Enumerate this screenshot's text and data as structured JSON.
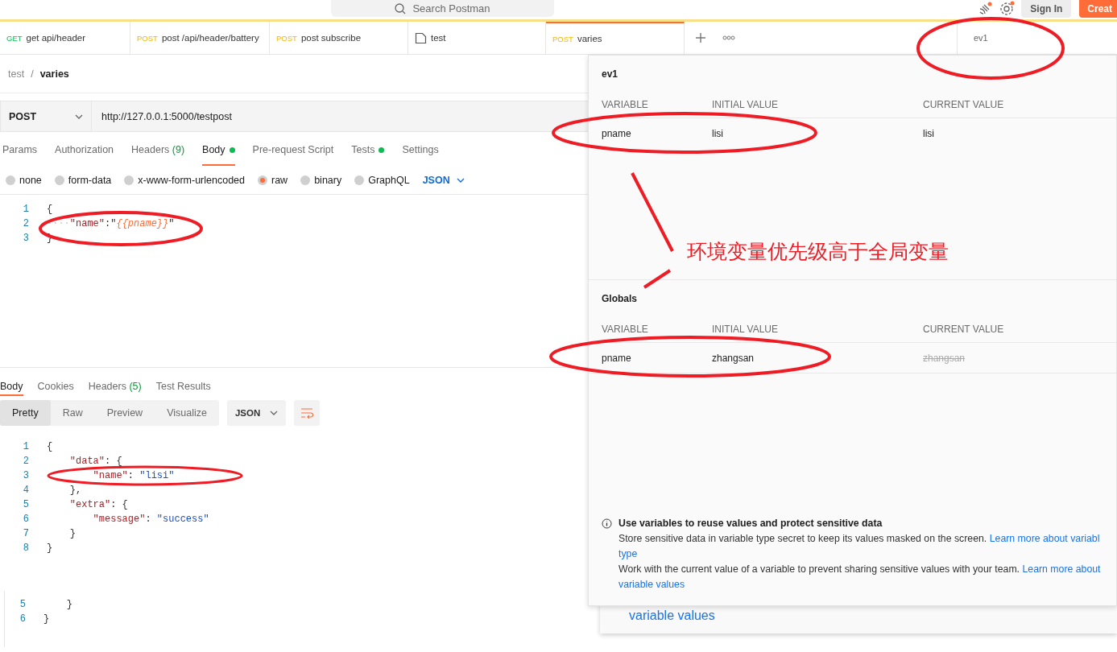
{
  "top_bar": {
    "search_placeholder": "Search Postman",
    "sign_in": "Sign In",
    "create": "Creat"
  },
  "tabs": [
    {
      "method": "GET",
      "label": "get api/header",
      "kind": "request",
      "selected": false
    },
    {
      "method": "POST",
      "label": "post /api/header/battery",
      "kind": "request",
      "selected": false
    },
    {
      "method": "POST",
      "label": "post subscribe",
      "kind": "request",
      "selected": false
    },
    {
      "label": "test",
      "kind": "collection",
      "selected": false
    },
    {
      "method": "POST",
      "label": "varies",
      "kind": "request",
      "selected": true
    }
  ],
  "environment": "ev1",
  "breadcrumb": {
    "parent": "test",
    "separator": "/",
    "current": "varies"
  },
  "request": {
    "method": "POST",
    "url": "http://127.0.0.1:5000/testpost"
  },
  "request_tabs": [
    {
      "label": "Params",
      "selected": false,
      "dot": false
    },
    {
      "label": "Authorization",
      "selected": false,
      "dot": false
    },
    {
      "label": "Headers",
      "count": "(9)",
      "selected": false,
      "dot": false
    },
    {
      "label": "Body",
      "selected": true,
      "dot": true
    },
    {
      "label": "Pre-request Script",
      "selected": false,
      "dot": false
    },
    {
      "label": "Tests",
      "selected": false,
      "dot": true
    },
    {
      "label": "Settings",
      "selected": false,
      "dot": false
    }
  ],
  "body_types": [
    {
      "label": "none",
      "selected": false
    },
    {
      "label": "form-data",
      "selected": false
    },
    {
      "label": "x-www-form-urlencoded",
      "selected": false
    },
    {
      "label": "raw",
      "selected": true
    },
    {
      "label": "binary",
      "selected": false
    },
    {
      "label": "GraphQL",
      "selected": false
    }
  ],
  "body_format": "JSON",
  "request_body": [
    {
      "number": "1",
      "tokens": [
        {
          "kind": "punct",
          "text": "{"
        }
      ]
    },
    {
      "number": "2",
      "tokens": [
        {
          "kind": "ws",
          "text": "····"
        },
        {
          "kind": "key",
          "text": "\"name\""
        },
        {
          "kind": "punct",
          "text": ":\""
        },
        {
          "kind": "var",
          "text": "{{pname}}"
        },
        {
          "kind": "punct",
          "text": "\""
        }
      ]
    },
    {
      "number": "3",
      "tokens": [
        {
          "kind": "punct",
          "text": "}"
        }
      ]
    }
  ],
  "response_tabs": [
    {
      "label": "Body",
      "selected": true
    },
    {
      "label": "Cookies",
      "selected": false
    },
    {
      "label": "Headers",
      "count": "(5)",
      "selected": false
    },
    {
      "label": "Test Results",
      "selected": false
    }
  ],
  "view_modes": [
    {
      "label": "Pretty",
      "selected": true
    },
    {
      "label": "Raw",
      "selected": false
    },
    {
      "label": "Preview",
      "selected": false
    },
    {
      "label": "Visualize",
      "selected": false
    }
  ],
  "response_format": "JSON",
  "response_body": [
    {
      "number": "1",
      "tokens": [
        {
          "kind": "punct",
          "text": "{"
        }
      ]
    },
    {
      "number": "2",
      "tokens": [
        {
          "kind": "key",
          "text": "    \"data\""
        },
        {
          "kind": "punct",
          "text": ": {"
        }
      ]
    },
    {
      "number": "3",
      "tokens": [
        {
          "kind": "key",
          "text": "        \"name\""
        },
        {
          "kind": "punct",
          "text": ": "
        },
        {
          "kind": "str",
          "text": "\"lisi\""
        }
      ]
    },
    {
      "number": "4",
      "tokens": [
        {
          "kind": "punct",
          "text": "    },"
        }
      ]
    },
    {
      "number": "5",
      "tokens": [
        {
          "kind": "key",
          "text": "    \"extra\""
        },
        {
          "kind": "punct",
          "text": ": {"
        }
      ]
    },
    {
      "number": "6",
      "tokens": [
        {
          "kind": "key",
          "text": "        \"message\""
        },
        {
          "kind": "punct",
          "text": ": "
        },
        {
          "kind": "str",
          "text": "\"success\""
        }
      ]
    },
    {
      "number": "7",
      "tokens": [
        {
          "kind": "punct",
          "text": "    }"
        }
      ]
    },
    {
      "number": "8",
      "tokens": [
        {
          "kind": "punct",
          "text": "}"
        }
      ]
    }
  ],
  "snippet": [
    {
      "number": "5",
      "tokens": [
        {
          "kind": "punct",
          "text": "    }"
        }
      ]
    },
    {
      "number": "6",
      "tokens": [
        {
          "kind": "punct",
          "text": "}"
        }
      ]
    }
  ],
  "variables_panel": {
    "sections": [
      {
        "title": "ev1",
        "columns": [
          "VARIABLE",
          "INITIAL VALUE",
          "CURRENT VALUE"
        ],
        "rows": [
          {
            "variable": "pname",
            "initial": "lisi",
            "current": "lisi",
            "overridden": false
          }
        ]
      },
      {
        "title": "Globals",
        "columns": [
          "VARIABLE",
          "INITIAL VALUE",
          "CURRENT VALUE"
        ],
        "rows": [
          {
            "variable": "pname",
            "initial": "zhangsan",
            "current": "zhangsan",
            "overridden": true
          }
        ]
      }
    ],
    "info": {
      "title": "Use variables to reuse values and protect sensitive data",
      "paragraphs": [
        {
          "text": "Store sensitive data in variable type secret to keep its values masked on the screen.",
          "link": "Learn more about variabl",
          "link_continued": "type"
        },
        {
          "text": "Work with the current value of a variable to prevent sharing sensitive values with your team.",
          "link": "Learn more about",
          "link_continued": "variable values"
        }
      ]
    }
  },
  "background_link": "variable values",
  "annotation": "环境变量优先级高于全局变量"
}
